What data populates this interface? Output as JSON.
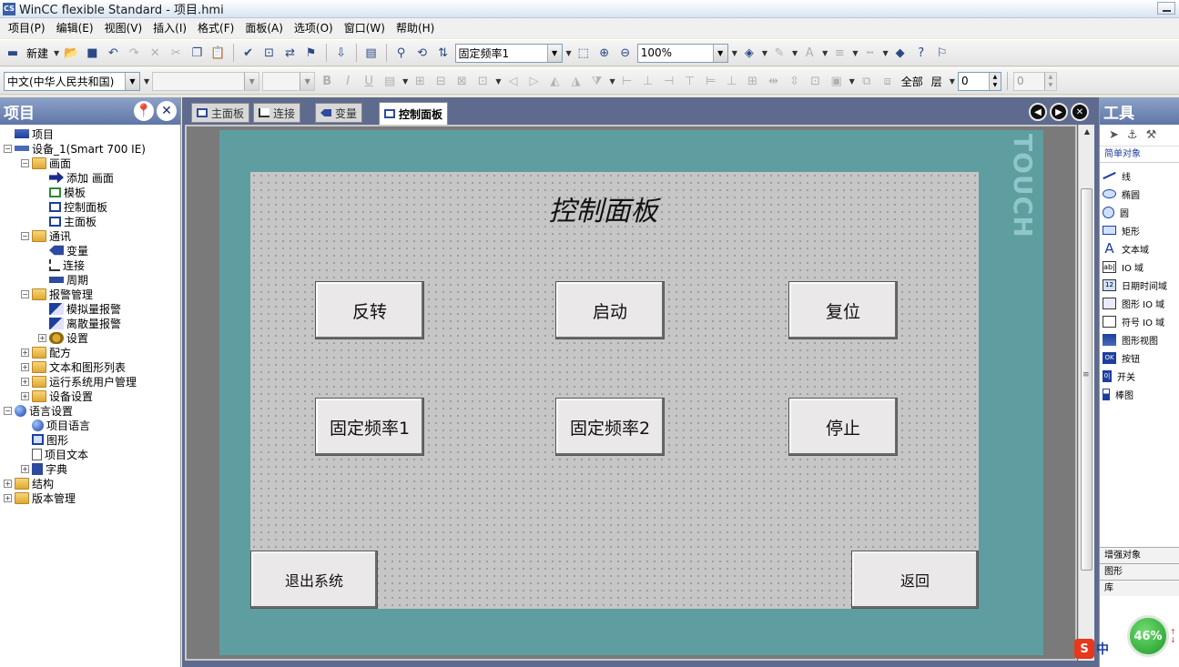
{
  "window": {
    "title": "WinCC flexible Standard - 项目.hmi",
    "app_icon_text": "CS"
  },
  "menu": [
    "项目(P)",
    "编辑(E)",
    "视图(V)",
    "插入(I)",
    "格式(F)",
    "面板(A)",
    "选项(O)",
    "窗口(W)",
    "帮助(H)"
  ],
  "toolbar1": {
    "new_label": "新建",
    "object_combo": "固定频率1",
    "zoom_combo": "100%"
  },
  "toolbar2": {
    "language_combo": "中文(中华人民共和国)",
    "font_combo": "",
    "size_combo": "",
    "all_label": "全部",
    "layer_label": "层",
    "layer_value": "0",
    "layer_value2": "0"
  },
  "project_panel": {
    "title": "项目",
    "tree": [
      {
        "level": 0,
        "icon": "proj",
        "label": "项目",
        "expand": ""
      },
      {
        "level": 0,
        "icon": "device",
        "label": "设备_1(Smart 700 IE)",
        "expand": "−"
      },
      {
        "level": 1,
        "icon": "folder",
        "label": "画面",
        "expand": "−"
      },
      {
        "level": 2,
        "icon": "add",
        "label": "添加 画面",
        "expand": ""
      },
      {
        "level": 2,
        "icon": "tmpl",
        "label": "模板",
        "expand": ""
      },
      {
        "level": 2,
        "icon": "screen",
        "label": "控制面板",
        "expand": ""
      },
      {
        "level": 2,
        "icon": "screen",
        "label": "主面板",
        "expand": ""
      },
      {
        "level": 1,
        "icon": "folder",
        "label": "通讯",
        "expand": "−"
      },
      {
        "level": 2,
        "icon": "tag",
        "label": "变量",
        "expand": ""
      },
      {
        "level": 2,
        "icon": "conn",
        "label": "连接",
        "expand": ""
      },
      {
        "level": 2,
        "icon": "cycle",
        "label": "周期",
        "expand": ""
      },
      {
        "level": 1,
        "icon": "folder",
        "label": "报警管理",
        "expand": "−"
      },
      {
        "level": 2,
        "icon": "alarm",
        "label": "模拟量报警",
        "expand": ""
      },
      {
        "level": 2,
        "icon": "alarm",
        "label": "离散量报警",
        "expand": ""
      },
      {
        "level": 2,
        "icon": "gear",
        "label": "设置",
        "expand": "+"
      },
      {
        "level": 1,
        "icon": "folder",
        "label": "配方",
        "expand": "+"
      },
      {
        "level": 1,
        "icon": "folder",
        "label": "文本和图形列表",
        "expand": "+"
      },
      {
        "level": 1,
        "icon": "folder",
        "label": "运行系统用户管理",
        "expand": "+"
      },
      {
        "level": 1,
        "icon": "folder",
        "label": "设备设置",
        "expand": "+"
      },
      {
        "level": 0,
        "icon": "globe",
        "label": "语言设置",
        "expand": "−"
      },
      {
        "level": 1,
        "icon": "globe",
        "label": "项目语言",
        "expand": ""
      },
      {
        "level": 1,
        "icon": "graphic",
        "label": "图形",
        "expand": ""
      },
      {
        "level": 1,
        "icon": "doc",
        "label": "项目文本",
        "expand": ""
      },
      {
        "level": 1,
        "icon": "book",
        "label": "字典",
        "expand": "+"
      },
      {
        "level": 0,
        "icon": "folder",
        "label": "结构",
        "expand": "+"
      },
      {
        "level": 0,
        "icon": "folder",
        "label": "版本管理",
        "expand": "+"
      }
    ]
  },
  "tabs": [
    {
      "label": "主面板",
      "icon": "screen",
      "active": false
    },
    {
      "label": "连接",
      "icon": "conn",
      "active": false
    },
    {
      "label": "变量",
      "icon": "tag",
      "active": false
    },
    {
      "label": "控制面板",
      "icon": "screen",
      "active": true
    }
  ],
  "hmi": {
    "device_brand_text": "TOUCH",
    "title": "控制面板",
    "buttons": [
      {
        "id": "reverse",
        "label": "反转"
      },
      {
        "id": "start",
        "label": "启动"
      },
      {
        "id": "reset",
        "label": "复位"
      },
      {
        "id": "freq1",
        "label": "固定频率1"
      },
      {
        "id": "freq2",
        "label": "固定频率2"
      },
      {
        "id": "stop",
        "label": "停止"
      },
      {
        "id": "exit",
        "label": "退出系统"
      },
      {
        "id": "back",
        "label": "返回"
      }
    ]
  },
  "tools_panel": {
    "title": "工具",
    "section_simple": "简单对象",
    "items": [
      {
        "icon": "line",
        "label": "线"
      },
      {
        "icon": "ellipse",
        "label": "椭圆"
      },
      {
        "icon": "circle",
        "label": "圆"
      },
      {
        "icon": "rect",
        "label": "矩形"
      },
      {
        "icon": "textf",
        "label": "文本域"
      },
      {
        "icon": "io",
        "label": "IO 域"
      },
      {
        "icon": "datetime",
        "label": "日期时间域"
      },
      {
        "icon": "gio",
        "label": "图形 IO 域"
      },
      {
        "icon": "sio",
        "label": "符号 IO 域"
      },
      {
        "icon": "gview",
        "label": "图形视图"
      },
      {
        "icon": "btn",
        "label": "按钮"
      },
      {
        "icon": "switch",
        "label": "开关"
      },
      {
        "icon": "bar",
        "label": "棒图"
      }
    ],
    "section_enhanced": "增强对象",
    "section_graphics": "图形",
    "section_library": "库"
  },
  "overlay": {
    "ime_s": "S",
    "ime_zh": "中",
    "perf_percent": "46%"
  },
  "colors": {
    "device_frame": "#5e9da0",
    "hmi_background": "#c6c6c6",
    "panel_header": "#6f86b4"
  }
}
